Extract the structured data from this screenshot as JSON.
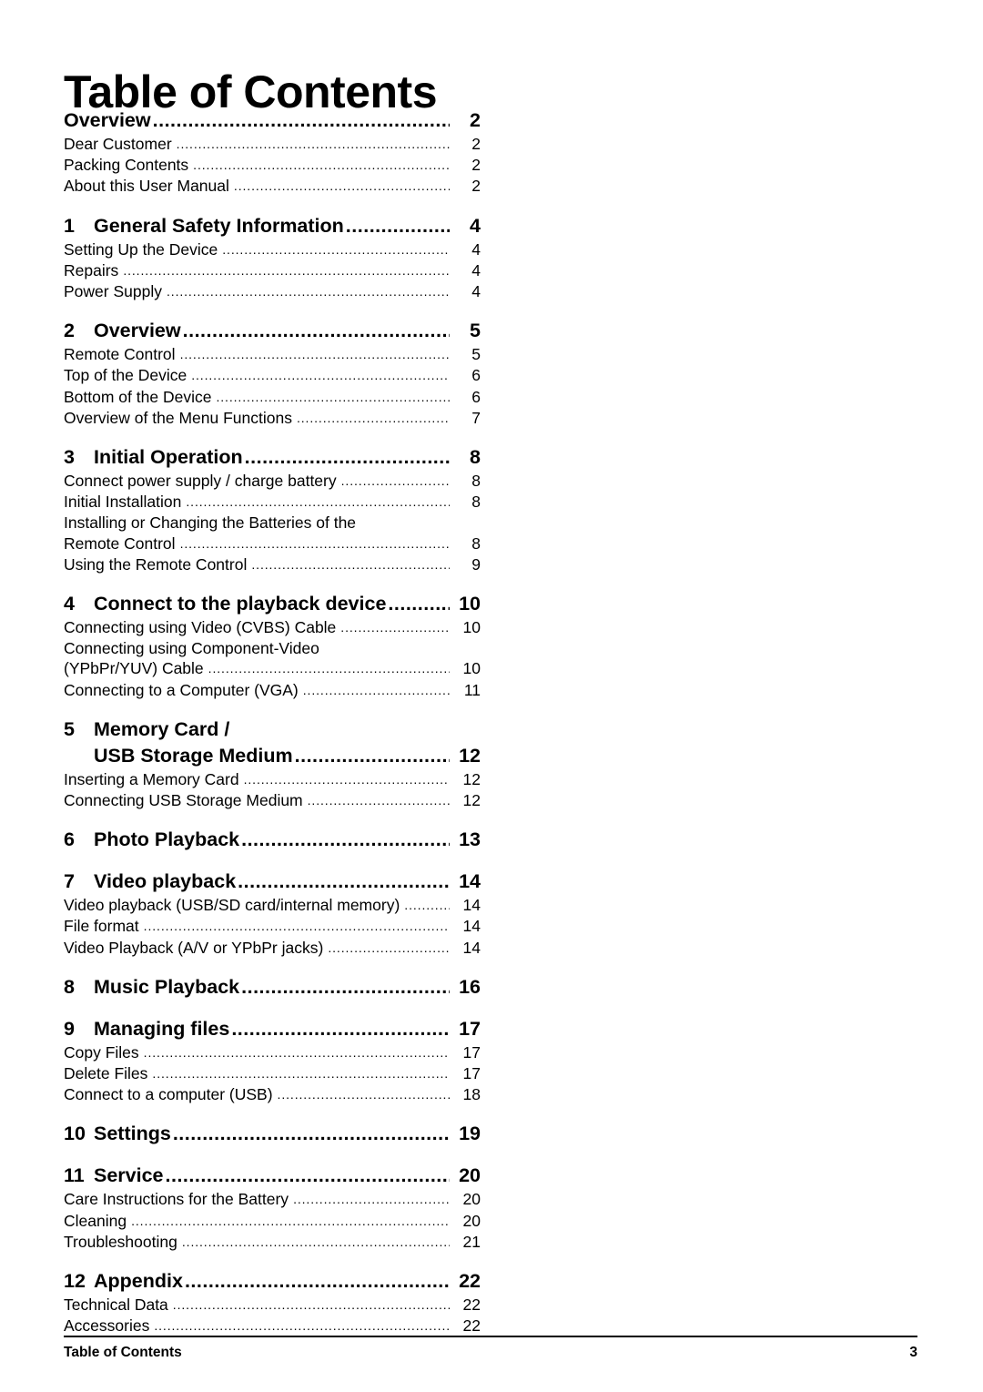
{
  "document": {
    "title": "Table of Contents"
  },
  "footer": {
    "label": "Table of Contents",
    "page_number": "3"
  },
  "leader_dots": "..................................................................................................................",
  "toc": {
    "entries": [
      {
        "type": "chapter",
        "number": "",
        "title": "Overview",
        "page": "2",
        "children": [
          {
            "title": "Dear Customer",
            "page": "2"
          },
          {
            "title": "Packing Contents",
            "page": "2"
          },
          {
            "title": "About this User Manual",
            "page": "2"
          }
        ]
      },
      {
        "type": "chapter",
        "number": "1",
        "title": "General Safety Information",
        "page": "4",
        "children": [
          {
            "title": "Setting Up the Device",
            "page": "4"
          },
          {
            "title": "Repairs",
            "page": "4"
          },
          {
            "title": "Power Supply",
            "page": "4"
          }
        ]
      },
      {
        "type": "chapter",
        "number": "2",
        "title": "Overview",
        "page": "5",
        "children": [
          {
            "title": "Remote Control",
            "page": "5"
          },
          {
            "title": "Top of the Device",
            "page": "6"
          },
          {
            "title": "Bottom of the Device",
            "page": "6"
          },
          {
            "title": "Overview of the Menu Functions",
            "page": "7"
          }
        ]
      },
      {
        "type": "chapter",
        "number": "3",
        "title": "Initial Operation",
        "page": "8",
        "children": [
          {
            "title": "Connect power supply / charge battery",
            "page": "8"
          },
          {
            "title": "Initial Installation",
            "page": "8"
          },
          {
            "first_line": "Installing or Changing the Batteries of the",
            "title": "Remote Control",
            "page": "8"
          },
          {
            "title": "Using the Remote Control",
            "page": "9"
          }
        ]
      },
      {
        "type": "chapter",
        "number": "4",
        "title": "Connect to the playback device",
        "page": "10",
        "children": [
          {
            "title": "Connecting using Video (CVBS) Cable",
            "page": "10"
          },
          {
            "first_line": "Connecting using Component-Video",
            "title": "(YPbPr/YUV) Cable",
            "page": "10"
          },
          {
            "title": "Connecting to a Computer (VGA)",
            "page": "11"
          }
        ]
      },
      {
        "type": "chapter",
        "number": "5",
        "title": "Memory Card /",
        "title_line2": "USB Storage Medium",
        "page": "12",
        "children": [
          {
            "title": "Inserting a Memory Card",
            "page": "12"
          },
          {
            "title": "Connecting USB Storage Medium",
            "page": "12"
          }
        ]
      },
      {
        "type": "chapter",
        "number": "6",
        "title": "Photo Playback",
        "page": "13",
        "children": []
      },
      {
        "type": "chapter",
        "number": "7",
        "title": "Video playback",
        "page": "14",
        "children": [
          {
            "title": "Video playback (USB/SD card/internal memory)",
            "page": "14"
          },
          {
            "title": "File format",
            "page": "14"
          },
          {
            "title": "Video Playback (A/V or YPbPr jacks)",
            "page": "14"
          }
        ]
      },
      {
        "type": "chapter",
        "number": "8",
        "title": "Music Playback",
        "page": "16",
        "children": []
      },
      {
        "type": "chapter",
        "number": "9",
        "title": "Managing files",
        "page": "17",
        "children": [
          {
            "title": "Copy Files",
            "page": "17"
          },
          {
            "title": "Delete Files",
            "page": "17"
          },
          {
            "title": "Connect to a computer (USB)",
            "page": "18"
          }
        ]
      },
      {
        "type": "chapter",
        "number": "10",
        "title": "Settings",
        "page": "19",
        "children": []
      },
      {
        "type": "chapter",
        "number": "11",
        "title": "Service",
        "page": "20",
        "children": [
          {
            "title": "Care Instructions for the Battery",
            "page": "20"
          },
          {
            "title": "Cleaning",
            "page": "20"
          },
          {
            "title": "Troubleshooting",
            "page": "21"
          }
        ]
      },
      {
        "type": "chapter",
        "number": "12",
        "title": "Appendix",
        "page": "22",
        "children": [
          {
            "title": "Technical Data",
            "page": "22"
          },
          {
            "title": "Accessories",
            "page": "22"
          }
        ]
      }
    ]
  }
}
